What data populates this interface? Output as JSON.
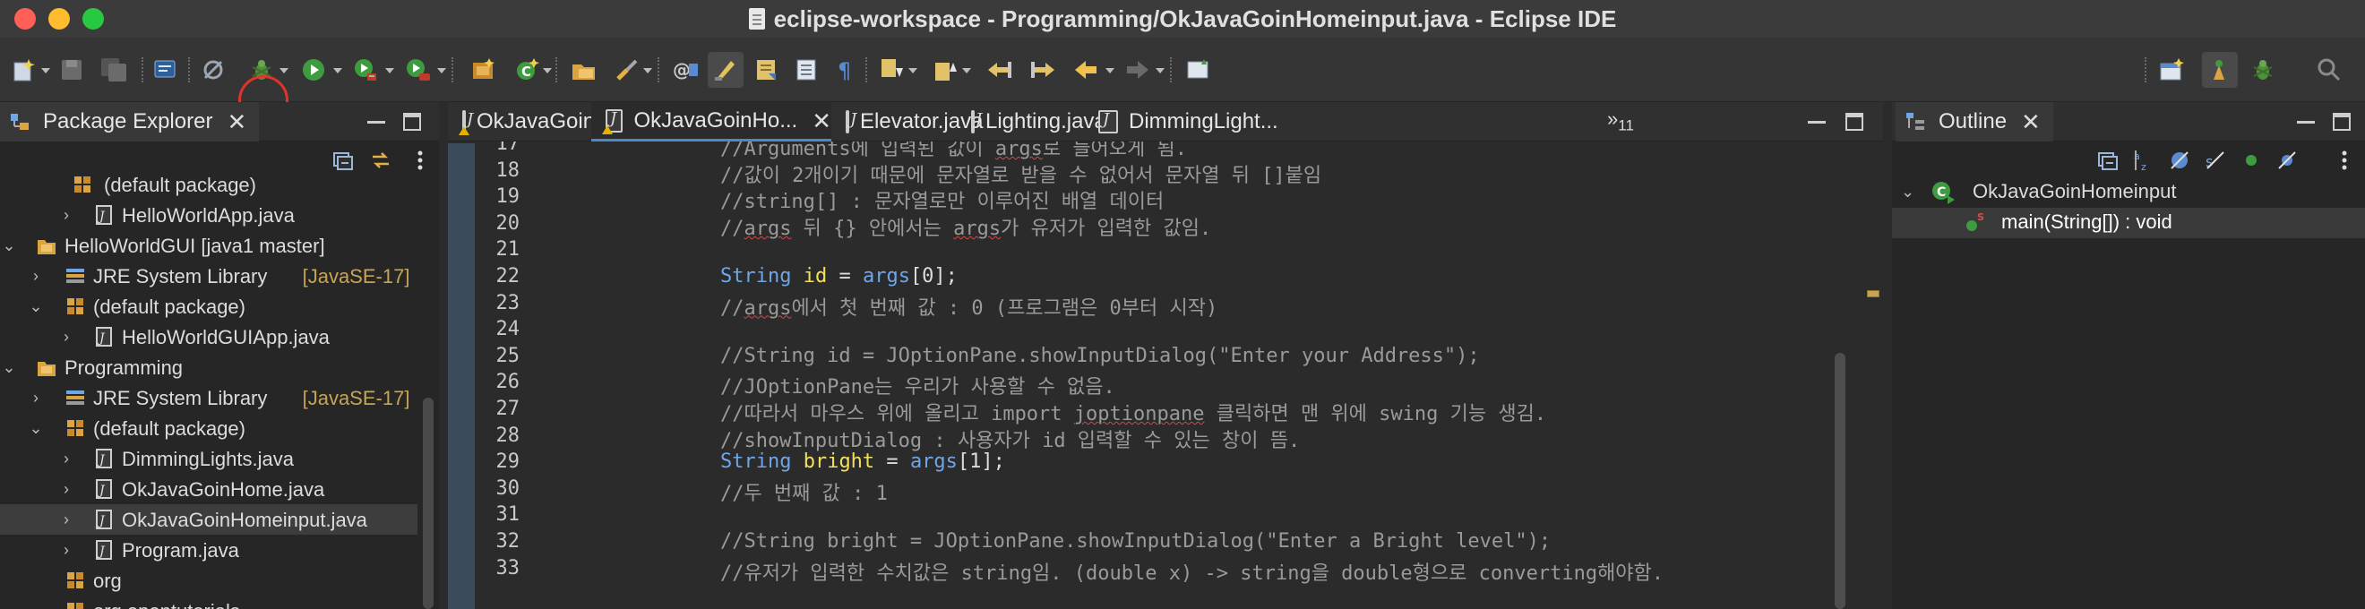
{
  "window": {
    "title": "eclipse-workspace - Programming/OkJavaGoinHomeinput.java - Eclipse IDE"
  },
  "toolbar": {
    "buttons": [
      "new-icon",
      "save-icon",
      "save-all-icon",
      "terminal-icon",
      "skip-breakpoints-icon",
      "debug-icon",
      "run-icon",
      "coverage-icon",
      "external-tools-icon",
      "new-java-project-icon",
      "new-class-icon",
      "open-type-icon",
      "search-icon",
      "open-task-icon",
      "toggle-mark-occurrences-icon",
      "toggle-block-selection-icon",
      "show-whitespace-icon",
      "next-annotation-icon",
      "previous-annotation-icon",
      "last-edit-icon",
      "back-icon",
      "forward-icon",
      "pin-editor-icon",
      "open-perspective-icon",
      "java-perspective-icon",
      "debug-perspective-icon",
      "search-field-icon"
    ]
  },
  "package_explorer": {
    "tab_label": "Package Explorer",
    "rows": [
      {
        "label": "(default package)",
        "decor": "",
        "kind": "package"
      },
      {
        "label": "HelloWorldApp.java",
        "decor": "",
        "kind": "java"
      },
      {
        "label": "HelloWorldGUI [java1 master]",
        "decor": "",
        "kind": "project"
      },
      {
        "label": "JRE System Library",
        "decor": "[JavaSE-17]",
        "kind": "library"
      },
      {
        "label": "(default package)",
        "decor": "",
        "kind": "package"
      },
      {
        "label": "HelloWorldGUIApp.java",
        "decor": "",
        "kind": "java"
      },
      {
        "label": "Programming",
        "decor": "",
        "kind": "project"
      },
      {
        "label": "JRE System Library",
        "decor": "[JavaSE-17]",
        "kind": "library"
      },
      {
        "label": "(default package)",
        "decor": "",
        "kind": "package"
      },
      {
        "label": "DimmingLights.java",
        "decor": "",
        "kind": "java"
      },
      {
        "label": "OkJavaGoinHome.java",
        "decor": "",
        "kind": "java"
      },
      {
        "label": "OkJavaGoinHomeinput.java",
        "decor": "",
        "kind": "java"
      },
      {
        "label": "Program.java",
        "decor": "",
        "kind": "java"
      },
      {
        "label": "org",
        "decor": "",
        "kind": "package"
      },
      {
        "label": "org.opentutorials",
        "decor": "",
        "kind": "package"
      }
    ]
  },
  "editor": {
    "tabs": [
      {
        "label": "OkJavaGoinHo...",
        "active": false
      },
      {
        "label": "OkJavaGoinHo...",
        "active": true
      },
      {
        "label": "Elevator.java",
        "active": false
      },
      {
        "label": "Lighting.java",
        "active": false
      },
      {
        "label": "DimmingLight...",
        "active": false
      }
    ],
    "more_tabs_label": "»",
    "more_tabs_count": "11",
    "lines": [
      {
        "n": "17",
        "code": "        //Arguments에 입력된 값이 args로 들어오게 됨."
      },
      {
        "n": "18",
        "code": "        //값이 2개이기 때문에 문자열로 받을 수 없어서 문자열 뒤 []붙임"
      },
      {
        "n": "19",
        "code": "        //string[] : 문자열로만 이루어진 배열 데이터"
      },
      {
        "n": "20",
        "code": "        //args 뒤 {} 안에서는 args가 유저가 입력한 값임."
      },
      {
        "n": "21",
        "code": ""
      },
      {
        "n": "22",
        "code": "        String id = args[0];"
      },
      {
        "n": "23",
        "code": "        //args에서 첫 번째 값 : 0 (프로그램은 0부터 시작)"
      },
      {
        "n": "24",
        "code": ""
      },
      {
        "n": "25",
        "code": "        //String id = JOptionPane.showInputDialog(\"Enter your Address\");"
      },
      {
        "n": "26",
        "code": "        //JOptionPane는 우리가 사용할 수 없음."
      },
      {
        "n": "27",
        "code": "        //따라서 마우스 위에 올리고 import joptionpane 클릭하면 맨 위에 swing 기능 생김."
      },
      {
        "n": "28",
        "code": "        //showInputDialog : 사용자가 id 입력할 수 있는 창이 뜸."
      },
      {
        "n": "29",
        "code": "        String bright = args[1];"
      },
      {
        "n": "30",
        "code": "        //두 번째 값 : 1"
      },
      {
        "n": "31",
        "code": ""
      },
      {
        "n": "32",
        "code": "        //String bright = JOptionPane.showInputDialog(\"Enter a Bright level\");"
      },
      {
        "n": "33",
        "code": "        //유저가 입력한 수치값은 string임. (double x) -> string을 double형으로 converting해야함."
      }
    ]
  },
  "outline": {
    "tab_label": "Outline",
    "class_label": "OkJavaGoinHomeinput",
    "method_label": "main(String[]) : void"
  },
  "colors": {
    "accent": "#4a88c7",
    "highlight_circle": "#e0332b",
    "library_decoration": "#c8a453"
  }
}
